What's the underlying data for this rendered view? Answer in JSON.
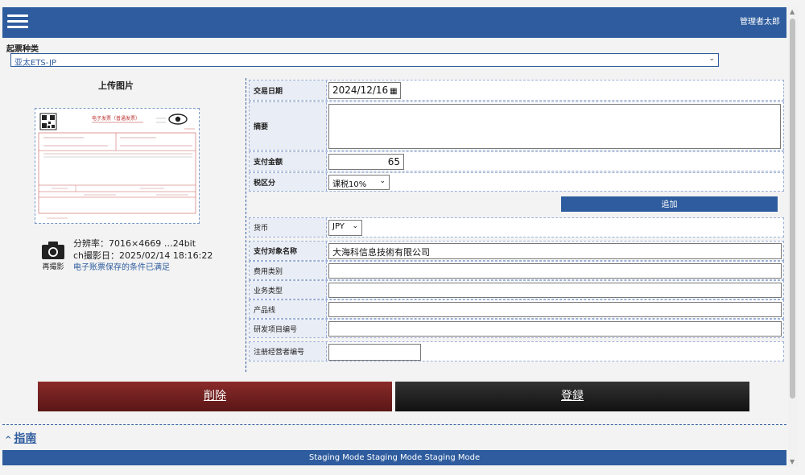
{
  "header": {
    "admin_name": "管理者太郎"
  },
  "doc_type": {
    "label": "起票种类",
    "selected": "亚太ETS-JP"
  },
  "upload": {
    "title": "上传图片",
    "retake_label": "再撮影",
    "resolution": "分辨率：7016×4669 …24bit",
    "capture_date": "ch撮影日：2025/02/14 18:16:22",
    "status_ok": "电子账票保存的条件已满足"
  },
  "receipt": {
    "title": "电子发票（普通发票）"
  },
  "form": {
    "trade_date": {
      "label": "交易日期",
      "value": "2024/12/16"
    },
    "summary": {
      "label": "摘要",
      "value": ""
    },
    "amount": {
      "label": "支付金额",
      "value": "65"
    },
    "tax": {
      "label": "税区分",
      "value": "课税10%"
    },
    "add_label": "追加",
    "currency": {
      "label": "货币",
      "value": "JPY"
    },
    "payee": {
      "label": "支付对象名称",
      "value": "大海科信息技術有限公司"
    },
    "expense_category": {
      "label": "费用类别",
      "value": ""
    },
    "business_type": {
      "label": "业务类型",
      "value": ""
    },
    "product_line": {
      "label": "产品线",
      "value": ""
    },
    "rd_project": {
      "label": "研发项目编号",
      "value": ""
    },
    "registration_no": {
      "label": "注册经营者编号",
      "value": ""
    }
  },
  "actions": {
    "delete_label": "削除",
    "register_label": "登録"
  },
  "guide": {
    "label": "指南"
  },
  "footer": {
    "staging_text": "Staging Mode Staging Mode Staging Mode"
  },
  "colors": {
    "primary": "#2e5c9e",
    "delete": "#7a2222",
    "register": "#1c1c1c"
  },
  "icons": {
    "menu": "hamburger-icon",
    "camera": "camera-icon",
    "calendar": "calendar-icon",
    "dropdown": "chevron-down-icon",
    "guide": "chevron-up-icon",
    "scroll_up": "triangle-up-icon",
    "scroll_down": "triangle-down-icon"
  }
}
